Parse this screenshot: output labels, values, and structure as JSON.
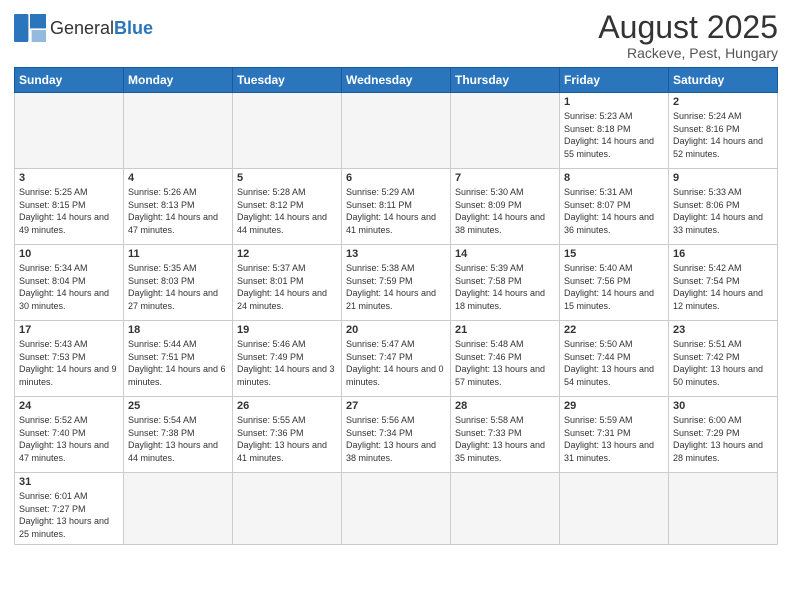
{
  "header": {
    "logo_general": "General",
    "logo_blue": "Blue",
    "title": "August 2025",
    "subtitle": "Rackeve, Pest, Hungary"
  },
  "weekdays": [
    "Sunday",
    "Monday",
    "Tuesday",
    "Wednesday",
    "Thursday",
    "Friday",
    "Saturday"
  ],
  "weeks": [
    [
      {
        "num": "",
        "info": ""
      },
      {
        "num": "",
        "info": ""
      },
      {
        "num": "",
        "info": ""
      },
      {
        "num": "",
        "info": ""
      },
      {
        "num": "",
        "info": ""
      },
      {
        "num": "1",
        "info": "Sunrise: 5:23 AM\nSunset: 8:18 PM\nDaylight: 14 hours and 55 minutes."
      },
      {
        "num": "2",
        "info": "Sunrise: 5:24 AM\nSunset: 8:16 PM\nDaylight: 14 hours and 52 minutes."
      }
    ],
    [
      {
        "num": "3",
        "info": "Sunrise: 5:25 AM\nSunset: 8:15 PM\nDaylight: 14 hours and 49 minutes."
      },
      {
        "num": "4",
        "info": "Sunrise: 5:26 AM\nSunset: 8:13 PM\nDaylight: 14 hours and 47 minutes."
      },
      {
        "num": "5",
        "info": "Sunrise: 5:28 AM\nSunset: 8:12 PM\nDaylight: 14 hours and 44 minutes."
      },
      {
        "num": "6",
        "info": "Sunrise: 5:29 AM\nSunset: 8:11 PM\nDaylight: 14 hours and 41 minutes."
      },
      {
        "num": "7",
        "info": "Sunrise: 5:30 AM\nSunset: 8:09 PM\nDaylight: 14 hours and 38 minutes."
      },
      {
        "num": "8",
        "info": "Sunrise: 5:31 AM\nSunset: 8:07 PM\nDaylight: 14 hours and 36 minutes."
      },
      {
        "num": "9",
        "info": "Sunrise: 5:33 AM\nSunset: 8:06 PM\nDaylight: 14 hours and 33 minutes."
      }
    ],
    [
      {
        "num": "10",
        "info": "Sunrise: 5:34 AM\nSunset: 8:04 PM\nDaylight: 14 hours and 30 minutes."
      },
      {
        "num": "11",
        "info": "Sunrise: 5:35 AM\nSunset: 8:03 PM\nDaylight: 14 hours and 27 minutes."
      },
      {
        "num": "12",
        "info": "Sunrise: 5:37 AM\nSunset: 8:01 PM\nDaylight: 14 hours and 24 minutes."
      },
      {
        "num": "13",
        "info": "Sunrise: 5:38 AM\nSunset: 7:59 PM\nDaylight: 14 hours and 21 minutes."
      },
      {
        "num": "14",
        "info": "Sunrise: 5:39 AM\nSunset: 7:58 PM\nDaylight: 14 hours and 18 minutes."
      },
      {
        "num": "15",
        "info": "Sunrise: 5:40 AM\nSunset: 7:56 PM\nDaylight: 14 hours and 15 minutes."
      },
      {
        "num": "16",
        "info": "Sunrise: 5:42 AM\nSunset: 7:54 PM\nDaylight: 14 hours and 12 minutes."
      }
    ],
    [
      {
        "num": "17",
        "info": "Sunrise: 5:43 AM\nSunset: 7:53 PM\nDaylight: 14 hours and 9 minutes."
      },
      {
        "num": "18",
        "info": "Sunrise: 5:44 AM\nSunset: 7:51 PM\nDaylight: 14 hours and 6 minutes."
      },
      {
        "num": "19",
        "info": "Sunrise: 5:46 AM\nSunset: 7:49 PM\nDaylight: 14 hours and 3 minutes."
      },
      {
        "num": "20",
        "info": "Sunrise: 5:47 AM\nSunset: 7:47 PM\nDaylight: 14 hours and 0 minutes."
      },
      {
        "num": "21",
        "info": "Sunrise: 5:48 AM\nSunset: 7:46 PM\nDaylight: 13 hours and 57 minutes."
      },
      {
        "num": "22",
        "info": "Sunrise: 5:50 AM\nSunset: 7:44 PM\nDaylight: 13 hours and 54 minutes."
      },
      {
        "num": "23",
        "info": "Sunrise: 5:51 AM\nSunset: 7:42 PM\nDaylight: 13 hours and 50 minutes."
      }
    ],
    [
      {
        "num": "24",
        "info": "Sunrise: 5:52 AM\nSunset: 7:40 PM\nDaylight: 13 hours and 47 minutes."
      },
      {
        "num": "25",
        "info": "Sunrise: 5:54 AM\nSunset: 7:38 PM\nDaylight: 13 hours and 44 minutes."
      },
      {
        "num": "26",
        "info": "Sunrise: 5:55 AM\nSunset: 7:36 PM\nDaylight: 13 hours and 41 minutes."
      },
      {
        "num": "27",
        "info": "Sunrise: 5:56 AM\nSunset: 7:34 PM\nDaylight: 13 hours and 38 minutes."
      },
      {
        "num": "28",
        "info": "Sunrise: 5:58 AM\nSunset: 7:33 PM\nDaylight: 13 hours and 35 minutes."
      },
      {
        "num": "29",
        "info": "Sunrise: 5:59 AM\nSunset: 7:31 PM\nDaylight: 13 hours and 31 minutes."
      },
      {
        "num": "30",
        "info": "Sunrise: 6:00 AM\nSunset: 7:29 PM\nDaylight: 13 hours and 28 minutes."
      }
    ],
    [
      {
        "num": "31",
        "info": "Sunrise: 6:01 AM\nSunset: 7:27 PM\nDaylight: 13 hours and 25 minutes."
      },
      {
        "num": "",
        "info": ""
      },
      {
        "num": "",
        "info": ""
      },
      {
        "num": "",
        "info": ""
      },
      {
        "num": "",
        "info": ""
      },
      {
        "num": "",
        "info": ""
      },
      {
        "num": "",
        "info": ""
      }
    ]
  ]
}
